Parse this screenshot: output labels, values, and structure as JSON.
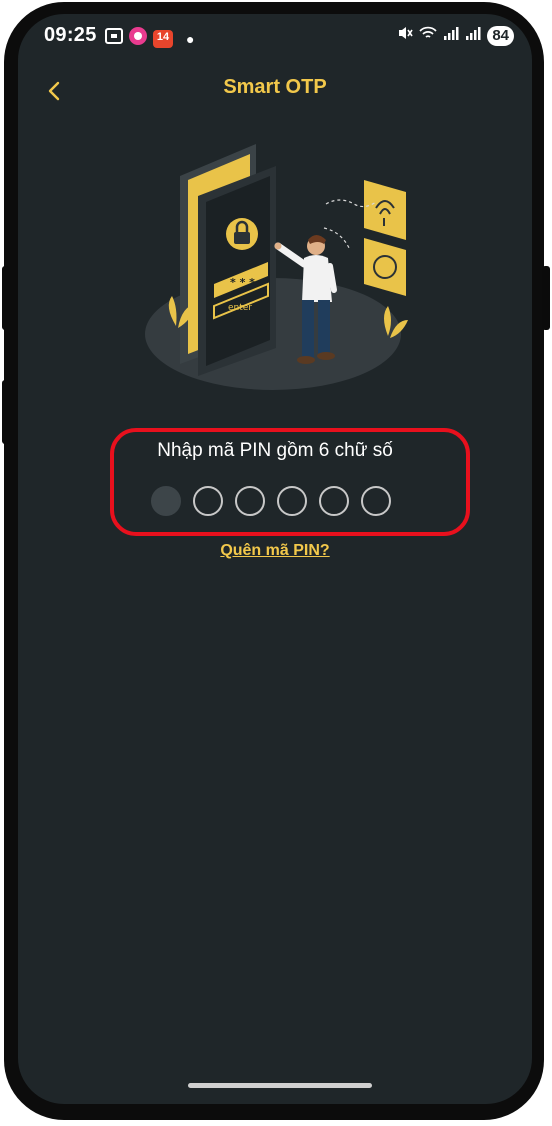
{
  "status_bar": {
    "time": "09:25",
    "notification_badge": "14",
    "battery_level": "84",
    "icons": [
      "screenshot-icon",
      "app-notification-icon",
      "calendar-badge-icon",
      "dot-icon",
      "mute-icon",
      "wifi-icon",
      "signal-icon",
      "signal-icon",
      "battery-icon"
    ]
  },
  "header": {
    "title": "Smart OTP",
    "back_icon": "chevron-left-icon"
  },
  "illustration": {
    "button_text": "enter",
    "code_text": "* * *"
  },
  "pin": {
    "label": "Nhập mã PIN gồm 6 chữ số",
    "length": 6,
    "filled": 0,
    "focused_index": 0
  },
  "forgot_pin_link": "Quên mã PIN?",
  "colors": {
    "accent": "#f2c84b",
    "background": "#1f2629",
    "highlight_border": "#e8101d"
  }
}
